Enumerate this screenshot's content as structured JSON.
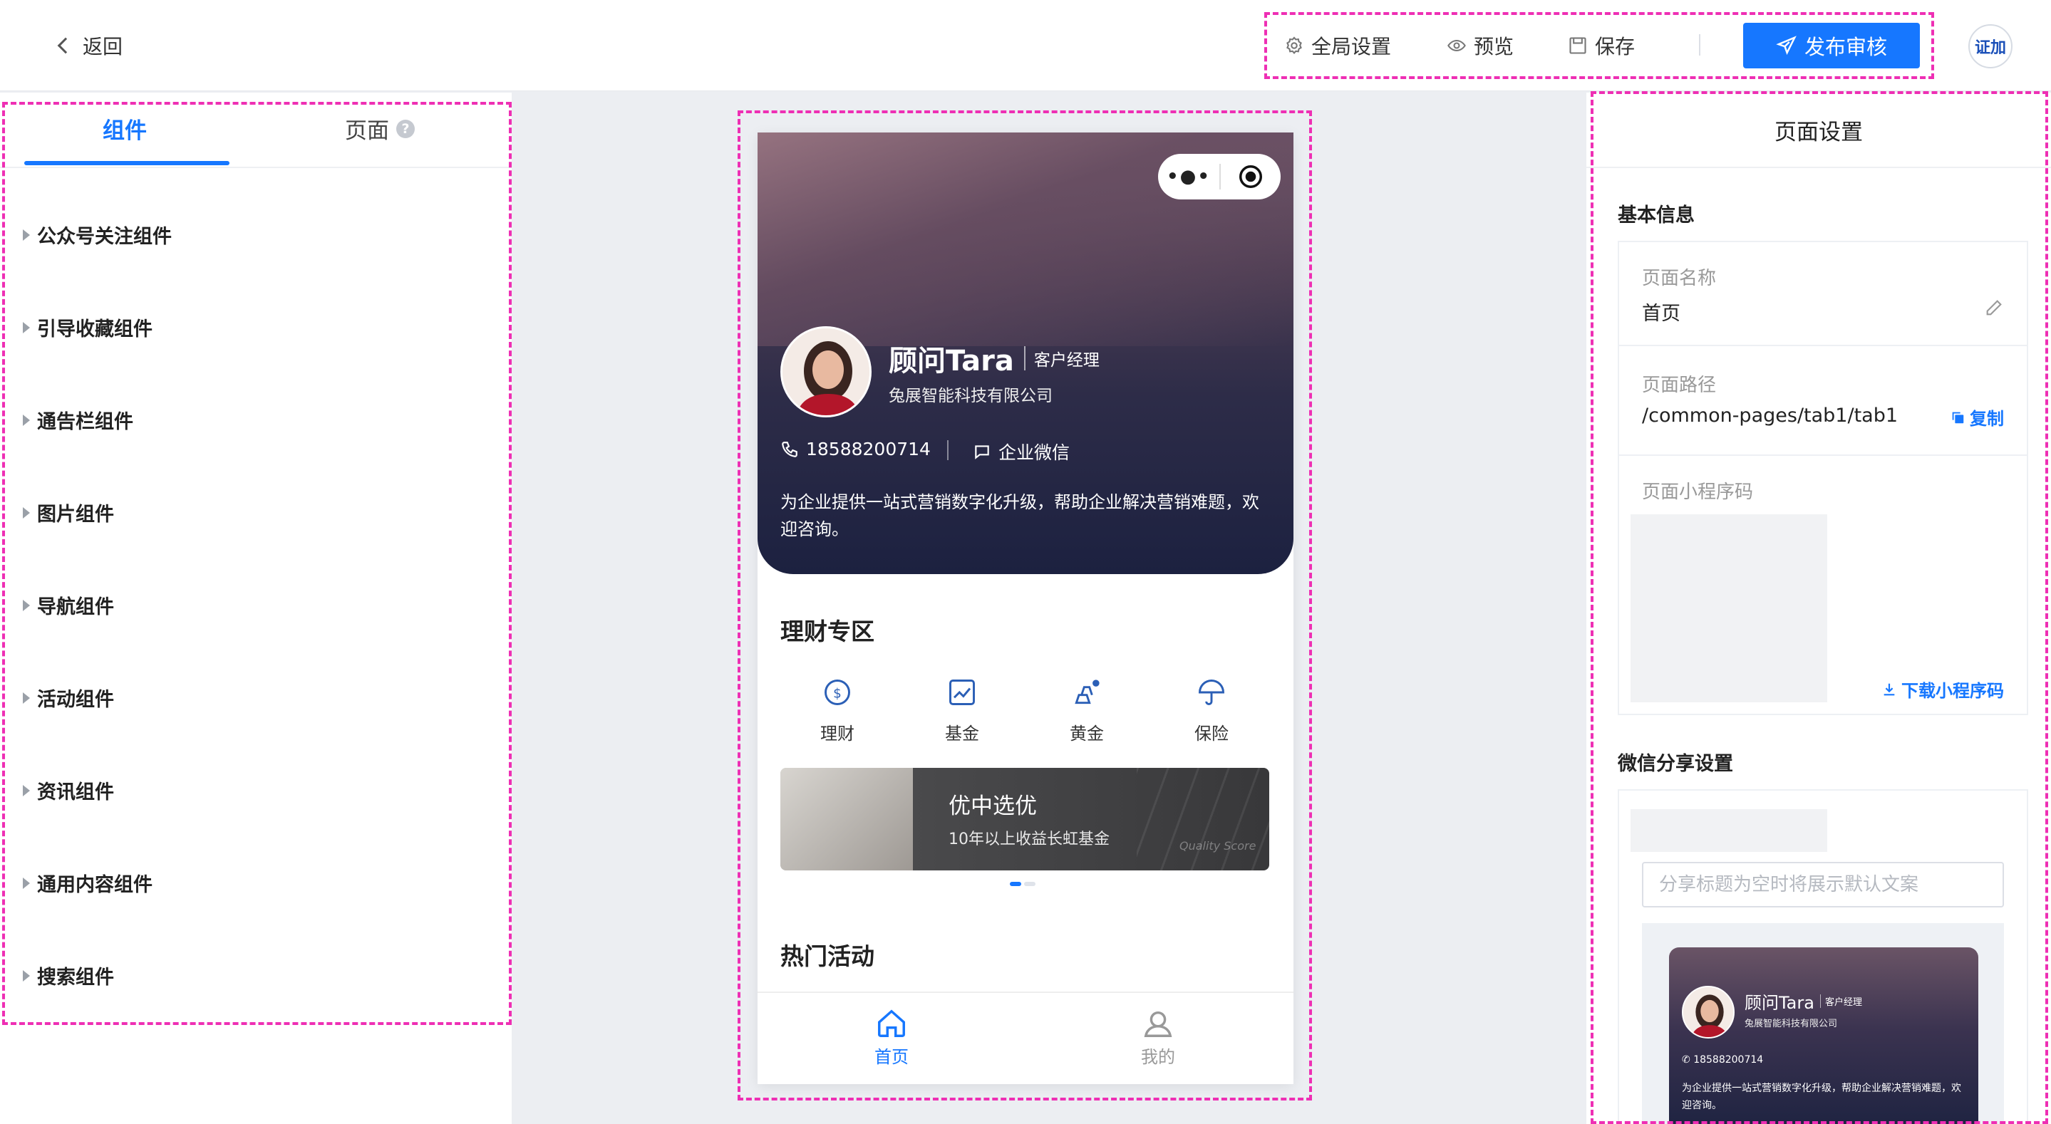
{
  "topbar": {
    "back_label": "返回",
    "tools": [
      {
        "label": "全局设置",
        "icon": "gear-icon"
      },
      {
        "label": "预览",
        "icon": "eye-icon"
      },
      {
        "label": "保存",
        "icon": "save-icon"
      }
    ],
    "publish_label": "发布审核",
    "avatar_text": "证加",
    "accent": "#1677ff"
  },
  "left_panel": {
    "tabs": [
      {
        "label": "组件",
        "active": true
      },
      {
        "label": "页面",
        "active": false
      }
    ],
    "groups": [
      "公众号关注组件",
      "引导收藏组件",
      "通告栏组件",
      "图片组件",
      "导航组件",
      "活动组件",
      "资讯组件",
      "通用内容组件",
      "搜索组件"
    ]
  },
  "phone": {
    "card": {
      "name": "顾问Tara",
      "title": "客户经理",
      "company": "兔展智能科技有限公司",
      "phone": "18588200714",
      "wechat": "企业微信",
      "intro": "为企业提供一站式营销数字化升级，帮助企业解决营销难题，欢迎咨询。"
    },
    "finance_title": "理财专区",
    "categories": [
      {
        "label": "理财",
        "icon": "coin-icon"
      },
      {
        "label": "基金",
        "icon": "chart-icon"
      },
      {
        "label": "黄金",
        "icon": "gold-icon"
      },
      {
        "label": "保险",
        "icon": "umbrella-icon"
      }
    ],
    "banner": {
      "title": "优中选优",
      "subtitle": "10年以上收益长虹基金",
      "overlay_text": "Quality Score"
    },
    "activity_title": "热门活动",
    "tabbar": [
      {
        "label": "首页",
        "active": true
      },
      {
        "label": "我的",
        "active": false
      }
    ]
  },
  "right_panel": {
    "title": "页面设置",
    "basic_title": "基本信息",
    "page_name_label": "页面名称",
    "page_name": "首页",
    "page_path_label": "页面路径",
    "page_path": "/common-pages/tab1/tab1",
    "copy_label": "复制",
    "qrcode_label": "页面小程序码",
    "download_label": "下载小程序码",
    "share_title": "微信分享设置",
    "share_placeholder": "分享标题为空时将展示默认文案",
    "preview": {
      "name": "顾问Tara",
      "title": "客户经理",
      "company": "兔展智能科技有限公司",
      "phone": "18588200714",
      "intro": "为企业提供一站式营销数字化升级，帮助企业解决营销难题，欢迎咨询。"
    }
  }
}
